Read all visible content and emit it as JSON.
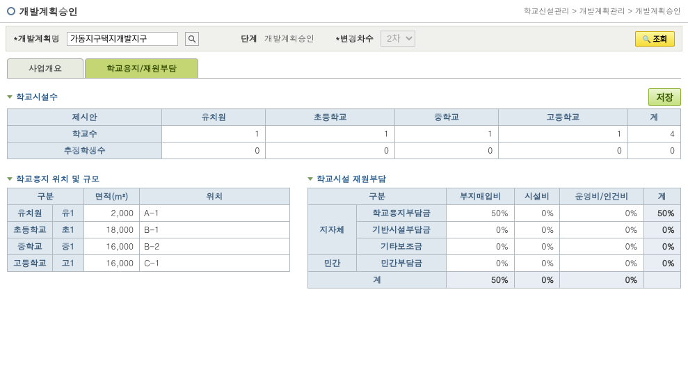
{
  "header": {
    "title": "개발계획승인",
    "breadcrumb": "학교신설관리 > 개발계획관리 > 개발계획승인"
  },
  "filter": {
    "plan_name_label": "개발계획명",
    "plan_name_value": "가동지구택지개발지구",
    "step_label": "단계",
    "step_value": "개발계획승인",
    "change_label": "변경차수",
    "change_value": "2차",
    "search_label": "조회"
  },
  "tabs": {
    "business": "사업개요",
    "site_fund": "학교용지/재원부담"
  },
  "facility": {
    "title": "학교시설수",
    "save_label": "저장",
    "headers": {
      "proposal": "제시안",
      "kinder": "유치원",
      "elem": "초등학교",
      "mid": "중학교",
      "high": "고등학교",
      "total": "계"
    },
    "rows": {
      "school_count": {
        "label": "학교수",
        "kinder": "1",
        "elem": "1",
        "mid": "1",
        "high": "1",
        "total": "4"
      },
      "student_est": {
        "label": "추정학생수",
        "kinder": "0",
        "elem": "0",
        "mid": "0",
        "high": "0",
        "total": "0"
      }
    }
  },
  "site": {
    "title": "학교용지 위치 및 규모",
    "headers": {
      "gubun": "구분",
      "area": "면적(m²)",
      "loc": "위치"
    },
    "rows": [
      {
        "type": "유치원",
        "code": "유1",
        "area": "2,000",
        "loc": "A-1"
      },
      {
        "type": "초등학교",
        "code": "초1",
        "area": "18,000",
        "loc": "B-1"
      },
      {
        "type": "중학교",
        "code": "중1",
        "area": "16,000",
        "loc": "B-2"
      },
      {
        "type": "고등학교",
        "code": "고1",
        "area": "16,000",
        "loc": "C-1"
      }
    ]
  },
  "fund": {
    "title": "학교시설 재원부담",
    "headers": {
      "gubun": "구분",
      "land": "부지매입비",
      "facility": "시설비",
      "operate": "운영비/인건비",
      "total": "계"
    },
    "groups": {
      "jija": "지자체",
      "min": "민간",
      "total": "계"
    },
    "rows": {
      "site_burden": {
        "label": "학교용지부담금",
        "land": "50%",
        "fac": "0%",
        "op": "0%",
        "tot": "50%"
      },
      "infra_burden": {
        "label": "기반시설부담금",
        "land": "0%",
        "fac": "0%",
        "op": "0%",
        "tot": "0%"
      },
      "etc_sub": {
        "label": "기타보조금",
        "land": "0%",
        "fac": "0%",
        "op": "0%",
        "tot": "0%"
      },
      "private": {
        "label": "민간부담금",
        "land": "0%",
        "fac": "0%",
        "op": "0%",
        "tot": "0%"
      },
      "total": {
        "land": "50%",
        "fac": "0%",
        "op": "0%",
        "tot": ""
      }
    }
  }
}
